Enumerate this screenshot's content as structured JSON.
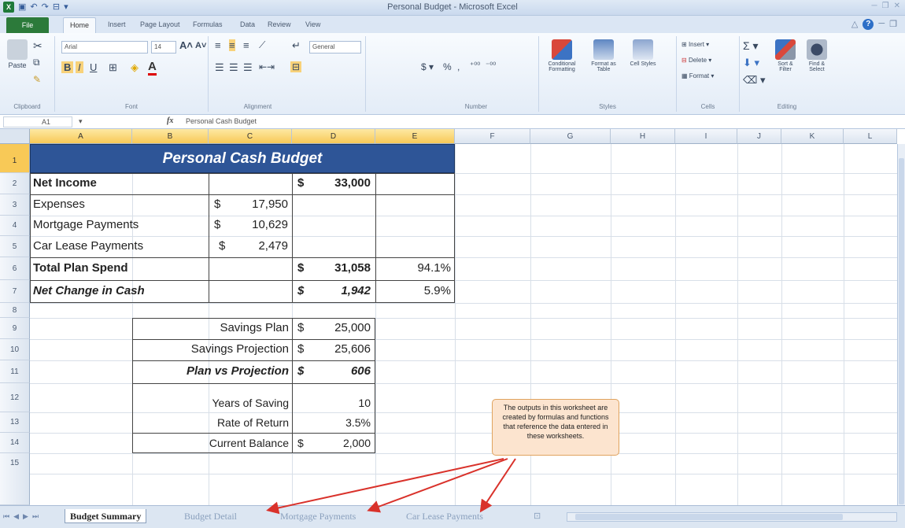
{
  "window": {
    "title": "Personal Budget - Microsoft Excel"
  },
  "ribbon": {
    "file_tab": "File",
    "tabs": [
      "Home",
      "Insert",
      "Page Layout",
      "Formulas",
      "Data",
      "Review",
      "View"
    ],
    "font_name": "Arial",
    "font_size": "14",
    "number_format": "General",
    "groups": {
      "clipboard": "Clipboard",
      "font": "Font",
      "alignment": "Alignment",
      "number": "Number",
      "styles": "Styles",
      "cells": "Cells",
      "editing": "Editing"
    },
    "buttons": {
      "paste": "Paste",
      "conditional_formatting": "Conditional Formatting",
      "format_as_table": "Format as Table",
      "cell_styles": "Cell Styles",
      "insert": "Insert",
      "delete": "Delete",
      "format": "Format",
      "sort_filter": "Sort & Filter",
      "find_select": "Find & Select"
    }
  },
  "formula_bar": {
    "name_box": "A1",
    "fx": "fx",
    "value": "Personal Cash Budget"
  },
  "columns": [
    "A",
    "B",
    "C",
    "D",
    "E",
    "F",
    "G",
    "H",
    "I",
    "J",
    "K",
    "L"
  ],
  "rows": [
    "1",
    "2",
    "3",
    "4",
    "5",
    "6",
    "7",
    "8",
    "9",
    "10",
    "11",
    "12",
    "13",
    "14",
    "15"
  ],
  "sheet": {
    "title": "Personal Cash Budget",
    "r2": {
      "label": "Net Income",
      "cur": "$",
      "val": "33,000"
    },
    "r3": {
      "label": "Expenses",
      "cur": "$",
      "val": "17,950"
    },
    "r4": {
      "label": "Mortgage Payments",
      "cur": "$",
      "val": "10,629"
    },
    "r5": {
      "label": "Car Lease Payments",
      "cur": "$",
      "val": "2,479"
    },
    "r6": {
      "label": "Total Plan Spend",
      "cur": "$",
      "val": "31,058",
      "pct": "94.1%"
    },
    "r7": {
      "label": "Net Change in Cash",
      "cur": "$",
      "val": "1,942",
      "pct": "5.9%"
    },
    "r9": {
      "label": "Savings Plan",
      "cur": "$",
      "val": "25,000"
    },
    "r10": {
      "label": "Savings Projection",
      "cur": "$",
      "val": "25,606"
    },
    "r11": {
      "label": "Plan vs Projection",
      "cur": "$",
      "val": "606"
    },
    "r12": {
      "label": "Years of Saving",
      "val": "10"
    },
    "r13": {
      "label": "Rate of Return",
      "val": "3.5%"
    },
    "r14": {
      "label": "Current Balance",
      "cur": "$",
      "val": "2,000"
    }
  },
  "callout": "The outputs in this worksheet are created by formulas and functions that reference the data entered in these worksheets.",
  "sheet_tabs": [
    "Budget Summary",
    "Budget Detail",
    "Mortgage Payments",
    "Car Lease Payments"
  ],
  "colors": {
    "title_fill": "#2e5597",
    "callout_fill": "#fce4cf",
    "callout_border": "#e0a35f",
    "arrow": "#d9322b"
  }
}
